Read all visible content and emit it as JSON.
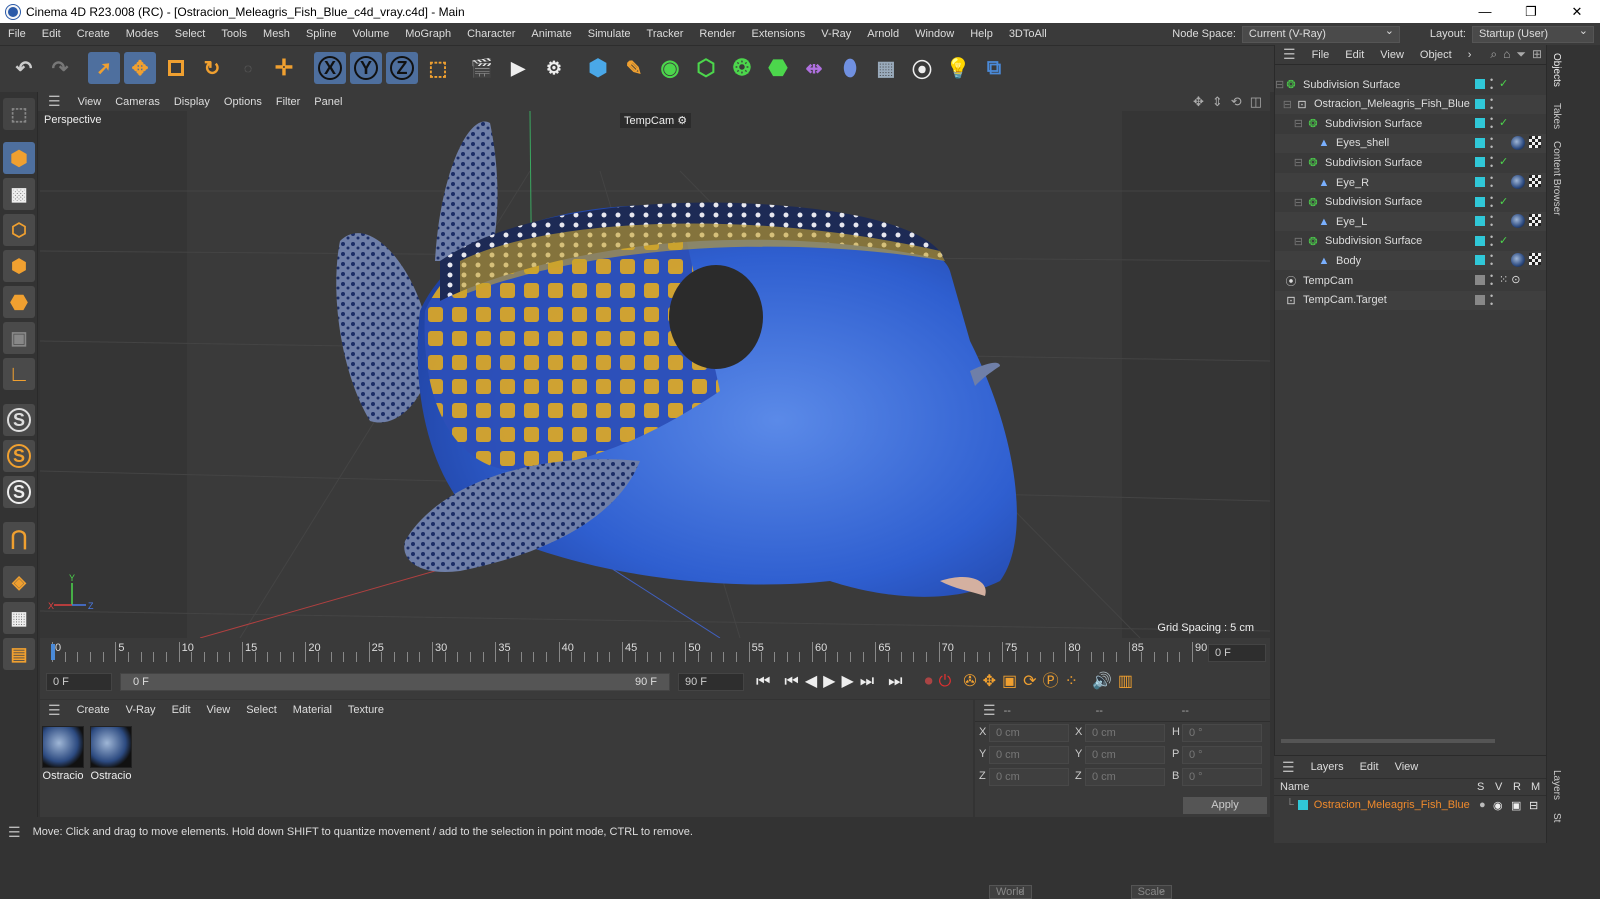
{
  "window": {
    "title": "Cinema 4D R23.008 (RC) - [Ostracion_Meleagris_Fish_Blue_c4d_vray.c4d] - Main",
    "minimize": "—",
    "maximize": "❐",
    "close": "✕"
  },
  "menubar": {
    "items": [
      "File",
      "Edit",
      "Create",
      "Modes",
      "Select",
      "Tools",
      "Mesh",
      "Spline",
      "Volume",
      "MoGraph",
      "Character",
      "Animate",
      "Simulate",
      "Tracker",
      "Render",
      "Extensions",
      "V-Ray",
      "Arnold",
      "Window",
      "Help",
      "3DToAll"
    ],
    "node_space_label": "Node Space:",
    "node_space_value": "Current (V-Ray)",
    "layout_label": "Layout:",
    "layout_value": "Startup (User)"
  },
  "viewport": {
    "menu": [
      "View",
      "Cameras",
      "Display",
      "Options",
      "Filter",
      "Panel"
    ],
    "view_name": "Perspective",
    "camera_label": "TempCam",
    "grid_spacing": "Grid Spacing : 5 cm",
    "axis_x": "X",
    "axis_y": "Y",
    "axis_z": "Z"
  },
  "timeline": {
    "ticks": [
      "0",
      "5",
      "10",
      "15",
      "20",
      "25",
      "30",
      "35",
      "40",
      "45",
      "50",
      "55",
      "60",
      "65",
      "70",
      "75",
      "80",
      "85",
      "90"
    ],
    "current_frame_field": "0 F",
    "start_field": "0 F",
    "range_start": "0 F",
    "range_end": "90 F",
    "end_field": "90 F"
  },
  "materials": {
    "menu": [
      "Create",
      "V-Ray",
      "Edit",
      "View",
      "Select",
      "Material",
      "Texture"
    ],
    "items": [
      {
        "label": "Ostracio"
      },
      {
        "label": "Ostracio"
      }
    ]
  },
  "coords": {
    "headers": [
      "--",
      "--",
      "--"
    ],
    "rows": [
      {
        "a": "X",
        "av": "0 cm",
        "b": "X",
        "bv": "0 cm",
        "c": "H",
        "cv": "0 °"
      },
      {
        "a": "Y",
        "av": "0 cm",
        "b": "Y",
        "bv": "0 cm",
        "c": "P",
        "cv": "0 °"
      },
      {
        "a": "Z",
        "av": "0 cm",
        "b": "Z",
        "bv": "0 cm",
        "c": "B",
        "cv": "0 °"
      }
    ],
    "world": "World",
    "scale": "Scale",
    "apply": "Apply"
  },
  "status": "Move: Click and drag to move elements. Hold down SHIFT to quantize movement / add to the selection in point mode, CTRL to remove.",
  "objects": {
    "menu": [
      "File",
      "Edit",
      "View",
      "Object"
    ],
    "rows": [
      {
        "name": "Subdivision Surface",
        "indent": 0
      },
      {
        "name": "Ostracion_Meleagris_Fish_Blue",
        "indent": 1
      },
      {
        "name": "Subdivision Surface",
        "indent": 2
      },
      {
        "name": "Eyes_shell",
        "indent": 3
      },
      {
        "name": "Subdivision Surface",
        "indent": 2
      },
      {
        "name": "Eye_R",
        "indent": 3
      },
      {
        "name": "Subdivision Surface",
        "indent": 2
      },
      {
        "name": "Eye_L",
        "indent": 3
      },
      {
        "name": "Subdivision Surface",
        "indent": 2
      },
      {
        "name": "Body",
        "indent": 3
      },
      {
        "name": "TempCam",
        "indent": 0
      },
      {
        "name": "TempCam.Target",
        "indent": 0
      }
    ]
  },
  "layers": {
    "menu": [
      "Layers",
      "Edit",
      "View"
    ],
    "col_name": "Name",
    "col_s": "S",
    "col_v": "V",
    "col_r": "R",
    "col_m": "M",
    "row": "Ostracion_Meleagris_Fish_Blue"
  },
  "sidetabs": [
    "Objects",
    "Takes",
    "Content Browser",
    "Layers",
    "St"
  ],
  "colors": {
    "accent": "#4e6f9e",
    "layer_orange": "#f08a2c",
    "cyan": "#30c8d8"
  }
}
